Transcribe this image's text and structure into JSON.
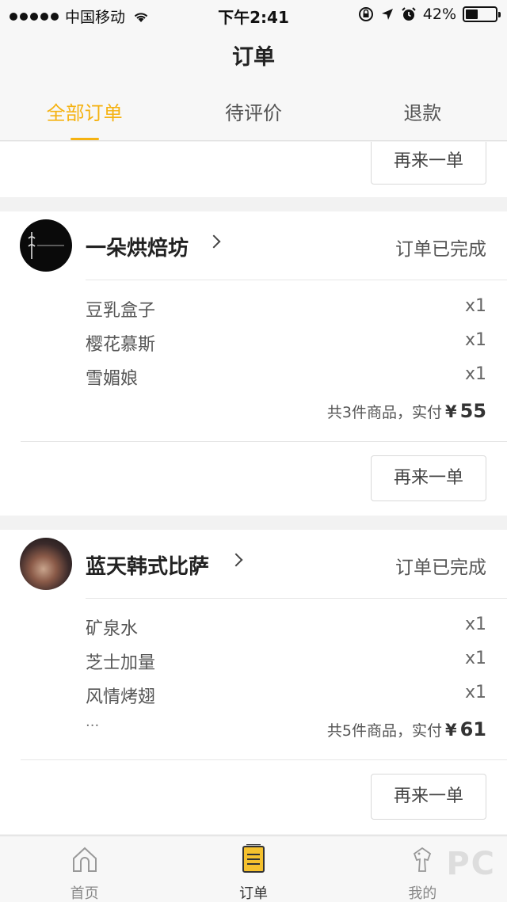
{
  "status_bar": {
    "carrier": "中国移动",
    "time": "下午2:41",
    "battery": "42%",
    "battery_level": 0.42
  },
  "nav": {
    "title": "订单"
  },
  "tabs": [
    {
      "label": "全部订单",
      "active": true
    },
    {
      "label": "待评价",
      "active": false
    },
    {
      "label": "退款",
      "active": false
    }
  ],
  "reorder_label": "再来一单",
  "orders": [
    {
      "shop_name": "一朵烘焙坊",
      "status": "订单已完成",
      "items": [
        {
          "name": "豆乳盒子",
          "qty": "x1"
        },
        {
          "name": "樱花慕斯",
          "qty": "x1"
        },
        {
          "name": "雪媚娘",
          "qty": "x1"
        }
      ],
      "summary_text": "共3件商品，实付",
      "currency": "¥",
      "amount": "55"
    },
    {
      "shop_name": "蓝天韩式比萨",
      "status": "订单已完成",
      "items": [
        {
          "name": "矿泉水",
          "qty": "x1"
        },
        {
          "name": "芝士加量",
          "qty": "x1"
        },
        {
          "name": "风情烤翅",
          "qty": "x1"
        }
      ],
      "more": "...",
      "summary_text": "共5件商品，实付",
      "currency": "¥",
      "amount": "61"
    }
  ],
  "tabbar": [
    {
      "label": "首页",
      "icon": "home-icon"
    },
    {
      "label": "订单",
      "icon": "order-list-icon"
    },
    {
      "label": "我的",
      "icon": "profile-icon"
    }
  ],
  "watermark": "PC",
  "colors": {
    "accent": "#f5b211",
    "background": "#f2f2f2"
  }
}
